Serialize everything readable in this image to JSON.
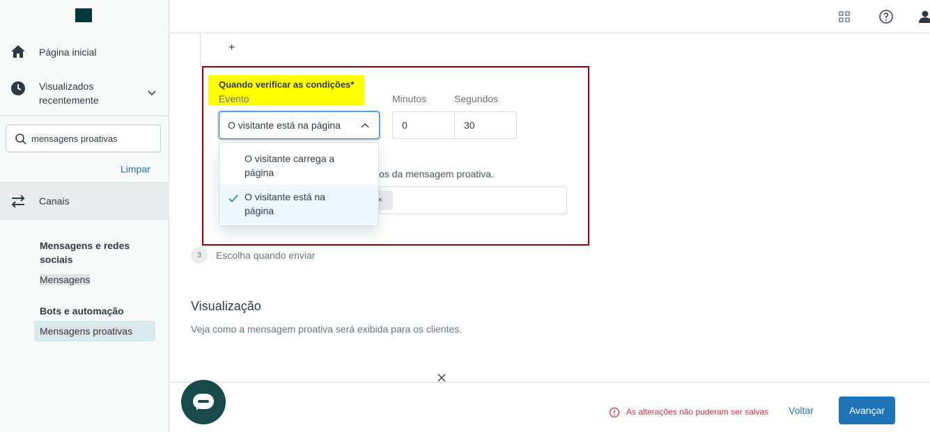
{
  "sidebar": {
    "home_label": "Página inicial",
    "recent_label": "Visualizados recentemente",
    "search_value": "mensagens proativas",
    "clear_label": "Limpar",
    "channels_label": "Canais",
    "group1_title": "Mensagens e redes sociais",
    "group1_item": "Mensagens",
    "group2_title": "Bots e automação",
    "group2_item_part1": "Mensagens",
    "group2_item_part2": "proativas"
  },
  "main": {
    "plus": "+",
    "conditions_title": "Quando verificar as condições*",
    "event_label": "Evento",
    "minutes_label": "Minutos",
    "seconds_label": "Segundos",
    "event_selected": "O visitante está na página",
    "minutes_value": "0",
    "seconds_value": "30",
    "partial_text": "os da mensagem proativa.",
    "tag_remove": "×",
    "dropdown_options": [
      {
        "label": "O visitante carrega a página",
        "selected": false
      },
      {
        "label": "O visitante está na página",
        "selected": true
      }
    ],
    "step_number": "3",
    "step_label": "Escolha quando enviar",
    "preview_title": "Visualização",
    "preview_desc": "Veja como a mensagem proativa será exibida para os clientes."
  },
  "footer": {
    "error_text": "As alterações não puderam ser salvas",
    "back_label": "Voltar",
    "next_label": "Avançar"
  },
  "colors": {
    "accent": "#1f73b7",
    "highlight": "#ffff00",
    "annotation_border": "#8b0000",
    "error": "#cc3340",
    "chat_bg": "#17494d"
  }
}
